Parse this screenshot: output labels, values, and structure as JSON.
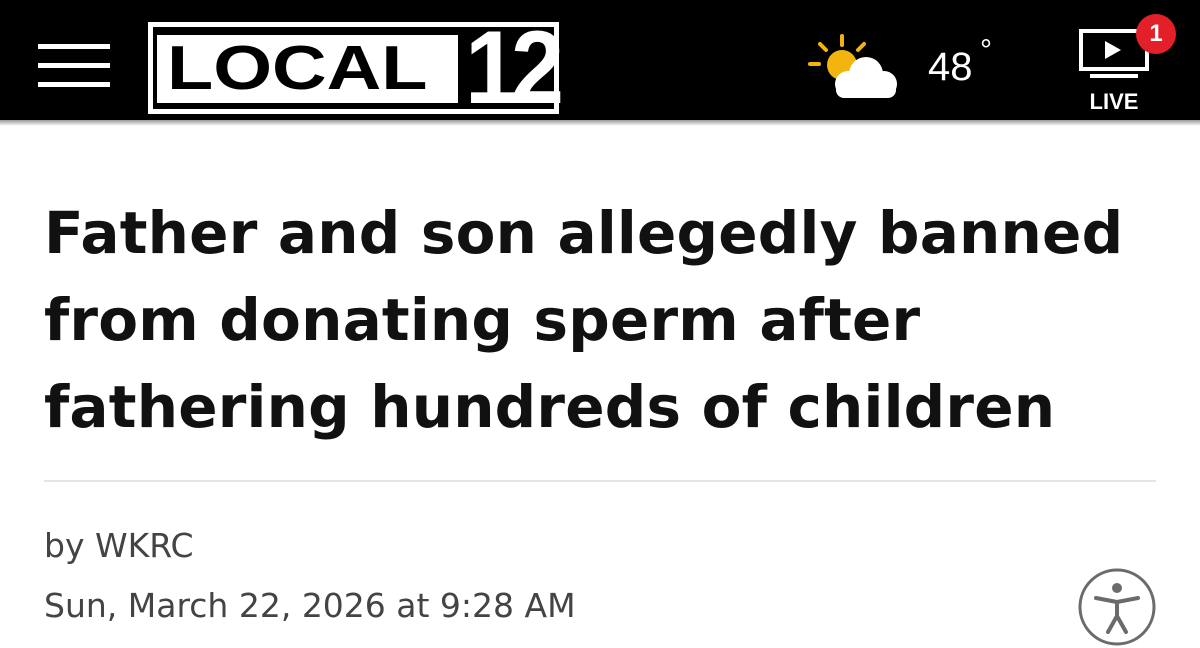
{
  "header": {
    "menu_icon": "hamburger-menu-icon",
    "logo": {
      "word": "LOCAL",
      "number": "12"
    },
    "weather": {
      "icon": "partly-sunny-icon",
      "temperature": "48",
      "degree_symbol": "°"
    },
    "live": {
      "icon": "live-video-icon",
      "label": "LIVE",
      "badge_count": "1"
    },
    "colors": {
      "bar_background": "#000000",
      "badge": "#e3202a",
      "sun": "#f2b40f"
    }
  },
  "article": {
    "headline": "Father and son allegedly banned from donating sperm after fathering hundreds of children",
    "byline": "by WKRC",
    "date": "Sun, March 22, 2026 at 9:28 AM"
  },
  "accessibility": {
    "icon": "accessibility-icon"
  }
}
